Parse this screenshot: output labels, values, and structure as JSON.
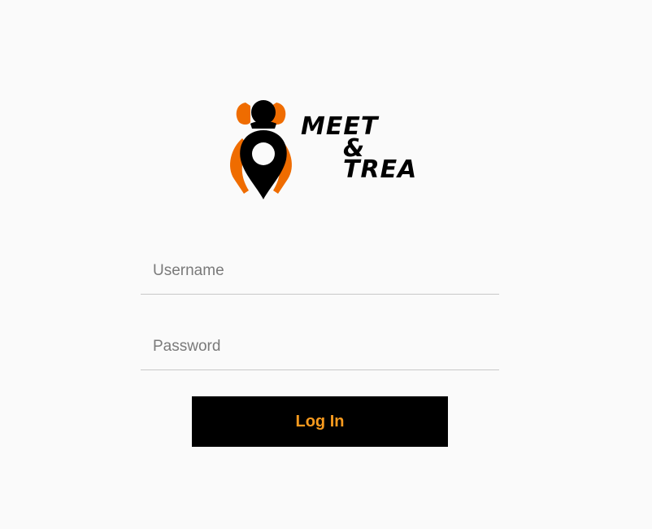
{
  "brand": {
    "logo_text": [
      "MEET",
      "&",
      "TREAT"
    ],
    "colors": {
      "accent": "#ef6c00",
      "dark": "#000000"
    },
    "icon": "pin-person-icon"
  },
  "form": {
    "username": {
      "placeholder": "Username",
      "value": ""
    },
    "password": {
      "placeholder": "Password",
      "value": ""
    },
    "login_label": "Log In",
    "login_color": "#f79a1e"
  }
}
